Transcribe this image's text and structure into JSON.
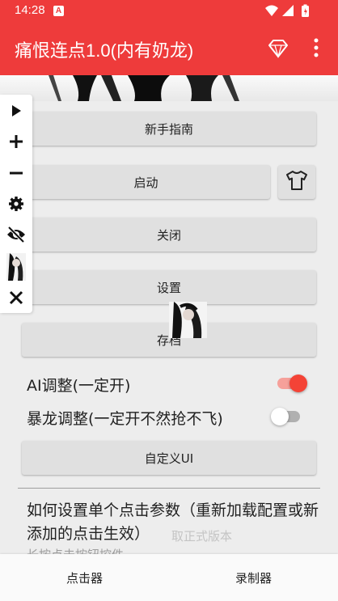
{
  "status_bar": {
    "time": "14:28",
    "notification_badge": "A",
    "icons": [
      "wifi-icon",
      "signal-icon",
      "battery-icon"
    ]
  },
  "app_bar": {
    "title": "痛恨连点1.0(内有奶龙)",
    "icons": [
      "diamond-icon",
      "more-vert-icon"
    ]
  },
  "buttons": {
    "guide": "新手指南",
    "start": "启动",
    "stop": "关闭",
    "settings": "设置",
    "save": "存档",
    "custom_ui": "自定义UI"
  },
  "toggles": [
    {
      "label": "AI调整(一定开)",
      "on": true
    },
    {
      "label": "暴龙调整(一定开不然抢不飞)",
      "on": false
    }
  ],
  "help": {
    "title": "如何设置单个点击参数（重新加载配置或新添加的点击生效）",
    "subtitle": "长按点击按钮控件",
    "overlay_text": "取正式版本"
  },
  "float_toolbar": {
    "items": [
      "play-icon",
      "plus-icon",
      "minus-icon",
      "settings-gear-icon",
      "visibility-off-icon",
      "avatar-thumbnail",
      "close-icon"
    ]
  },
  "bottom_nav": {
    "tabs": [
      {
        "label": "点击器",
        "active": true
      },
      {
        "label": "录制器",
        "active": false
      }
    ]
  },
  "colors": {
    "primary": "#ee3b3b",
    "background": "#eeeeee",
    "button": "#e0e0e0",
    "toggle_on_thumb": "#f44336",
    "toggle_on_track": "#f6a09a",
    "toggle_off_thumb": "#ffffff",
    "toggle_off_track": "#b0b0b0",
    "bottom_nav": "#fafafa"
  }
}
